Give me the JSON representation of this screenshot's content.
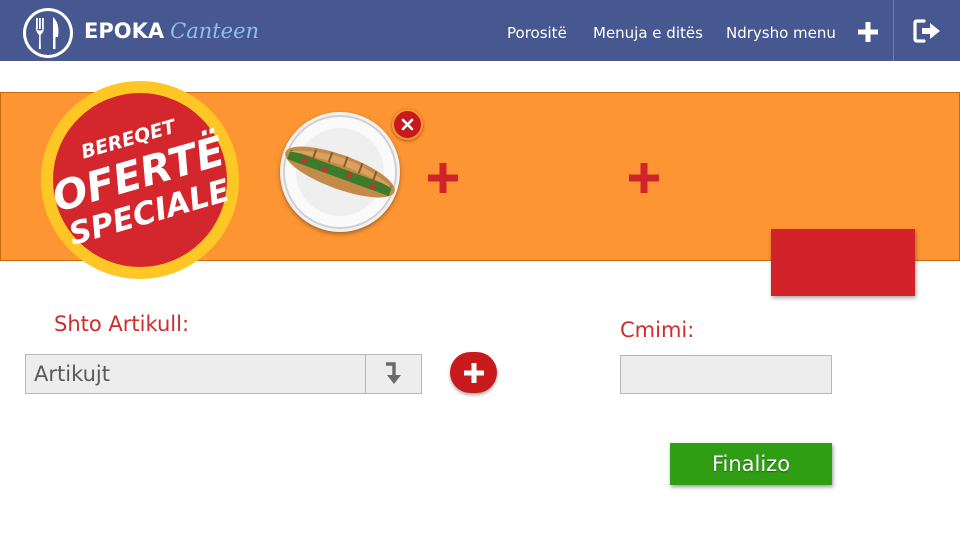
{
  "header": {
    "brand_name": "EPOKA",
    "brand_sub": "Canteen",
    "nav": [
      {
        "label": "Porositë"
      },
      {
        "label": "Menuja e ditës"
      },
      {
        "label": "Ndrysho menu"
      }
    ],
    "add_icon": "plus-icon",
    "logout_icon": "logout-icon",
    "logo_icon": "fork-knife-icon"
  },
  "offer": {
    "badge_line1": "BEREQET",
    "badge_line2": "OFERTË",
    "badge_line3": "SPECIALE",
    "item_image": "sandwich-plate",
    "remove_icon": "close-icon",
    "add_slot_icon": "plus-icon"
  },
  "form": {
    "add_item_label": "Shto Artikull:",
    "item_select_value": "Artikujt",
    "price_label": "Cmimi:",
    "price_value": "",
    "finalize_label": "Finalizo"
  },
  "colors": {
    "header_bg": "#475890",
    "band_bg": "#fe9533",
    "accent_red": "#c8191c",
    "label_red": "#cf2d2d",
    "finalize_green": "#2f9e14",
    "brand_sub": "#8ec0ea"
  }
}
